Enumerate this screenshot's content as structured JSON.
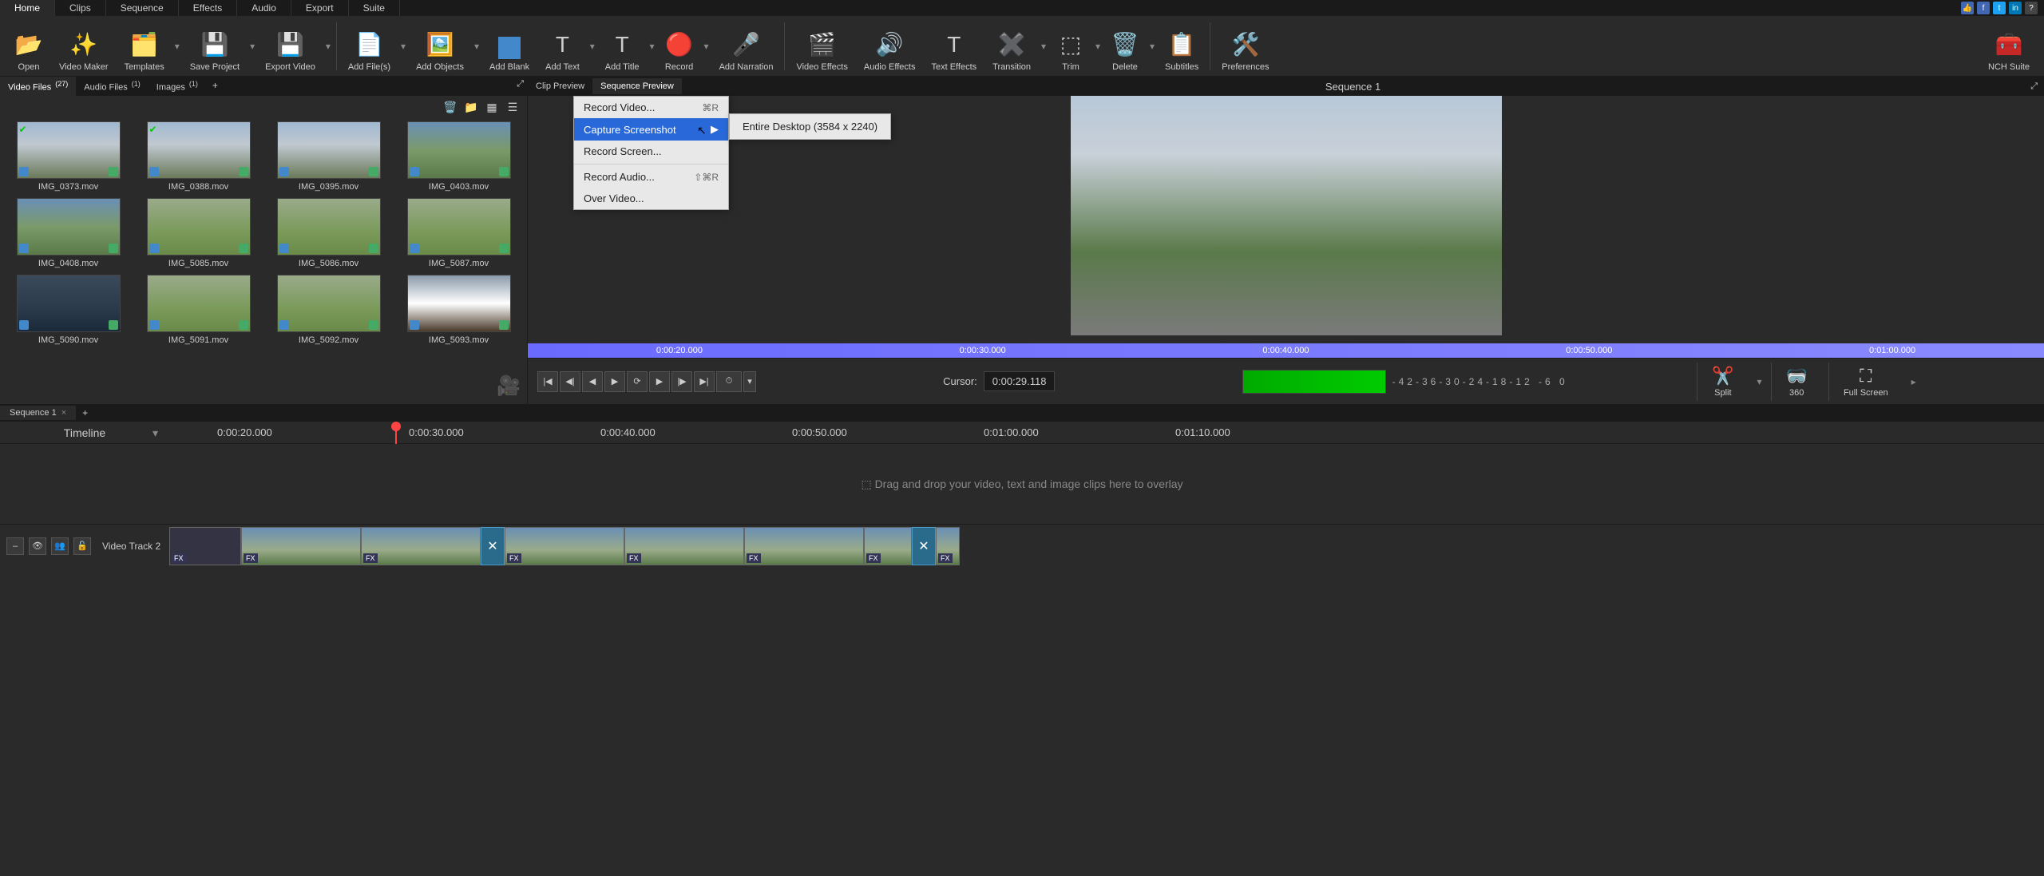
{
  "tabs": {
    "home": "Home",
    "clips": "Clips",
    "sequence": "Sequence",
    "effects": "Effects",
    "audio": "Audio",
    "export": "Export",
    "suite": "Suite"
  },
  "toolbar": {
    "open": "Open",
    "video_maker": "Video Maker",
    "templates": "Templates",
    "save_project": "Save Project",
    "export_video": "Export Video",
    "add_files": "Add File(s)",
    "add_objects": "Add Objects",
    "add_blank": "Add Blank",
    "add_text": "Add Text",
    "add_title": "Add Title",
    "record": "Record",
    "add_narration": "Add Narration",
    "video_effects": "Video Effects",
    "audio_effects": "Audio Effects",
    "text_effects": "Text Effects",
    "transition": "Transition",
    "trim": "Trim",
    "delete": "Delete",
    "subtitles": "Subtitles",
    "preferences": "Preferences",
    "nch_suite": "NCH Suite"
  },
  "media_tabs": {
    "video": "Video Files",
    "video_count": "(27)",
    "audio": "Audio Files",
    "audio_count": "(1)",
    "images": "Images",
    "images_count": "(1)"
  },
  "clips": [
    {
      "name": "IMG_0373.mov"
    },
    {
      "name": "IMG_0388.mov"
    },
    {
      "name": "IMG_0395.mov"
    },
    {
      "name": "IMG_0403.mov"
    },
    {
      "name": "IMG_0408.mov"
    },
    {
      "name": "IMG_5085.mov"
    },
    {
      "name": "IMG_5086.mov"
    },
    {
      "name": "IMG_5087.mov"
    },
    {
      "name": "IMG_5090.mov"
    },
    {
      "name": "IMG_5091.mov"
    },
    {
      "name": "IMG_5092.mov"
    },
    {
      "name": "IMG_5093.mov"
    }
  ],
  "preview": {
    "clip_tab": "Clip Preview",
    "seq_tab": "Sequence Preview",
    "title": "Sequence 1",
    "ruler": [
      "0:00:20.000",
      "0:00:30.000",
      "0:00:40.000",
      "0:00:50.000",
      "0:01:00.000"
    ],
    "cursor_label": "Cursor:",
    "cursor_value": "0:00:29.118",
    "db": "-42-36-30-24-18-12 -6  0",
    "split": "Split",
    "vr": "360",
    "fullscreen": "Full Screen"
  },
  "context_menu": {
    "record_video": "Record Video...",
    "record_video_sc": "⌘R",
    "capture": "Capture Screenshot",
    "record_screen": "Record Screen...",
    "record_audio": "Record Audio...",
    "record_audio_sc": "⇧⌘R",
    "over_video": "Over Video...",
    "entire_desktop": "Entire Desktop (3584 x 2240)"
  },
  "sequence": {
    "tab": "Sequence 1"
  },
  "timeline": {
    "label": "Timeline",
    "ticks": [
      "0:00:20.000",
      "0:00:30.000",
      "0:00:40.000",
      "0:00:50.000",
      "0:01:00.000",
      "0:01:10.000"
    ],
    "overlay_hint": "Drag and drop your video, text and image clips here to overlay",
    "track2": "Video Track 2"
  }
}
